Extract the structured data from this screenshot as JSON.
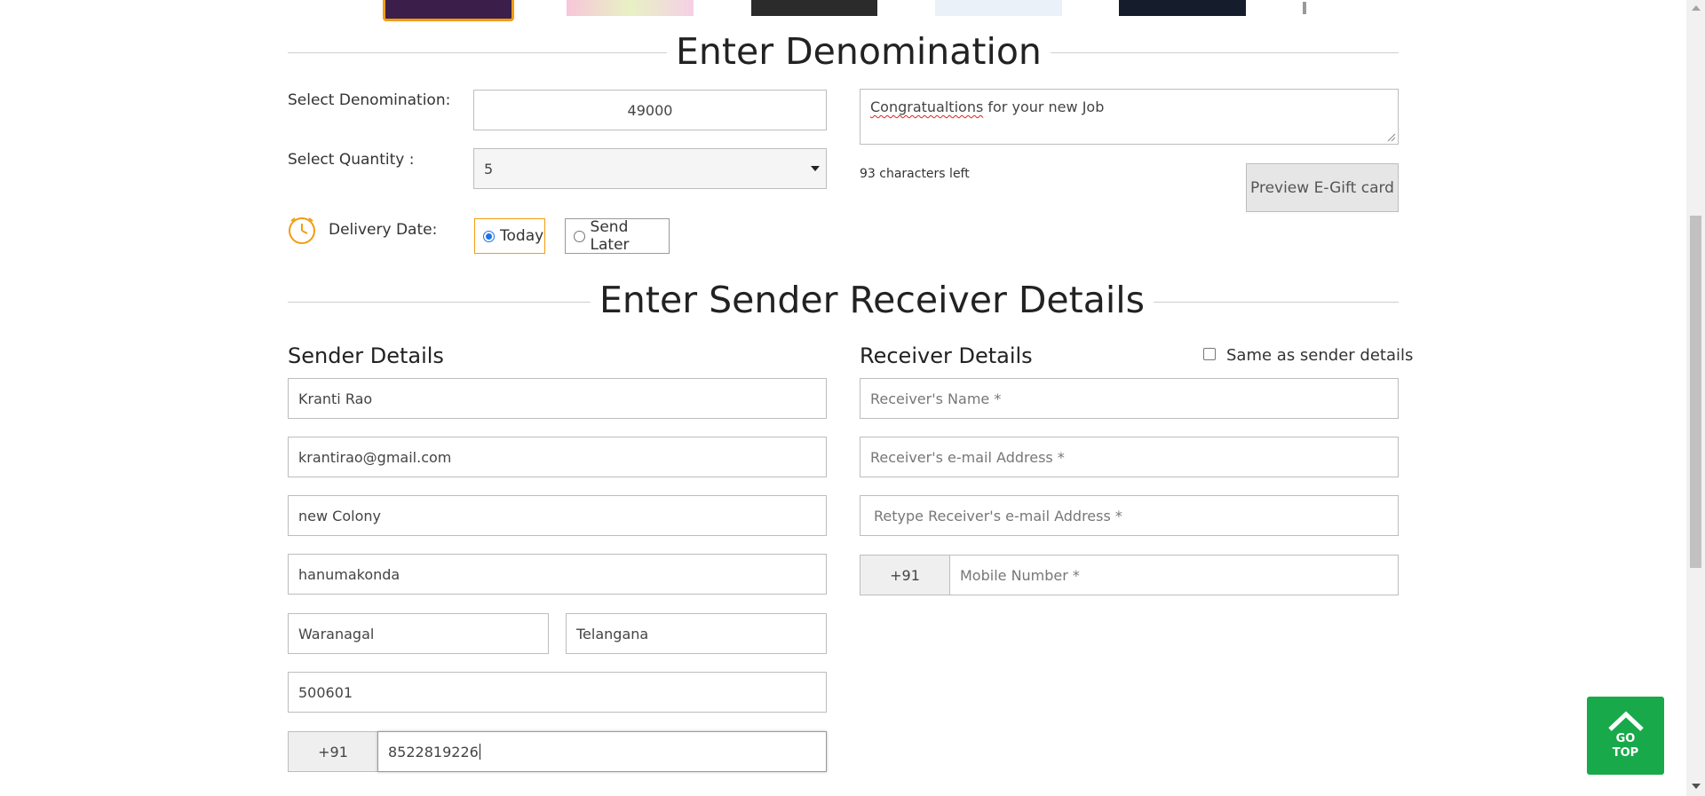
{
  "denomination_section": {
    "title": "Enter Denomination",
    "denomination_label": "Select Denomination:",
    "denomination_value": "49000",
    "quantity_label": "Select Quantity :",
    "quantity_value": "5",
    "delivery_label": "Delivery Date:",
    "delivery_options": [
      "Today",
      "Send Later"
    ],
    "delivery_selected": "Today",
    "message_misspelled_word": "Congratualtions",
    "message_rest": " for your new Job",
    "chars_left": "93 characters left",
    "preview_label": "Preview E-Gift card"
  },
  "details_section": {
    "title": "Enter Sender Receiver Details",
    "sender": {
      "heading": "Sender Details",
      "name": "Kranti Rao",
      "email": "krantirao@gmail.com",
      "address1": "new Colony",
      "address2": "hanumakonda",
      "city": "Waranagal",
      "state": "Telangana",
      "pincode": "500601",
      "country_code": "+91",
      "mobile": "8522819226"
    },
    "receiver": {
      "heading": "Receiver Details",
      "same_as_sender_label": "Same as sender details",
      "name_placeholder": "Receiver's Name *",
      "email_placeholder": "Receiver's e-mail Address *",
      "retype_email_placeholder": "Retype Receiver's e-mail Address *",
      "country_code": "+91",
      "mobile_placeholder": "Mobile Number *"
    }
  },
  "go_top_label": "GO TOP",
  "icons": {
    "clock": "clock-icon",
    "go_top": "chevron-up-icon"
  },
  "colors": {
    "accent_orange": "#f39c12",
    "go_top_green": "#18a94b",
    "radio_blue": "#1a73e8"
  }
}
